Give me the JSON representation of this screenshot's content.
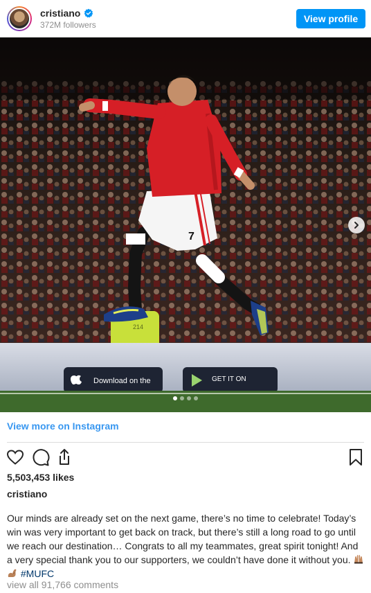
{
  "header": {
    "username": "cristiano",
    "followers": "372M followers",
    "view_profile_label": "View profile"
  },
  "post": {
    "carousel": {
      "total_slides": 4,
      "active_index": 0
    },
    "photo_text": {
      "jersey_number": "7",
      "ad_board_apple": "Download on the",
      "ad_board_google": "GET IT ON",
      "vest_number": "214"
    },
    "view_more_label": "View more on Instagram",
    "likes": "5,503,453 likes",
    "caption_user": "cristiano",
    "caption_text": "Our minds are already set on the next game, there’s no time to celebrate! Today’s win was very important to get back on track, but there’s still a long road to go until we reach our destination… Congrats to all my teammates, great spirit tonight! And a very special thank you to our supporters, we couldn’t have done it without you.",
    "hashtag": "#MUFC",
    "comments_label": "view all 91,766 comments",
    "icons": [
      "heart-icon",
      "comment-icon",
      "share-icon",
      "bookmark-icon",
      "chevron-right-icon",
      "verified-icon",
      "raising-hands-emoji",
      "flexed-biceps-emoji"
    ]
  },
  "colors": {
    "brand_blue": "#0095f6",
    "link_blue": "#3897f0",
    "hashtag_blue": "#00376b",
    "kit_red": "#d61f26"
  }
}
